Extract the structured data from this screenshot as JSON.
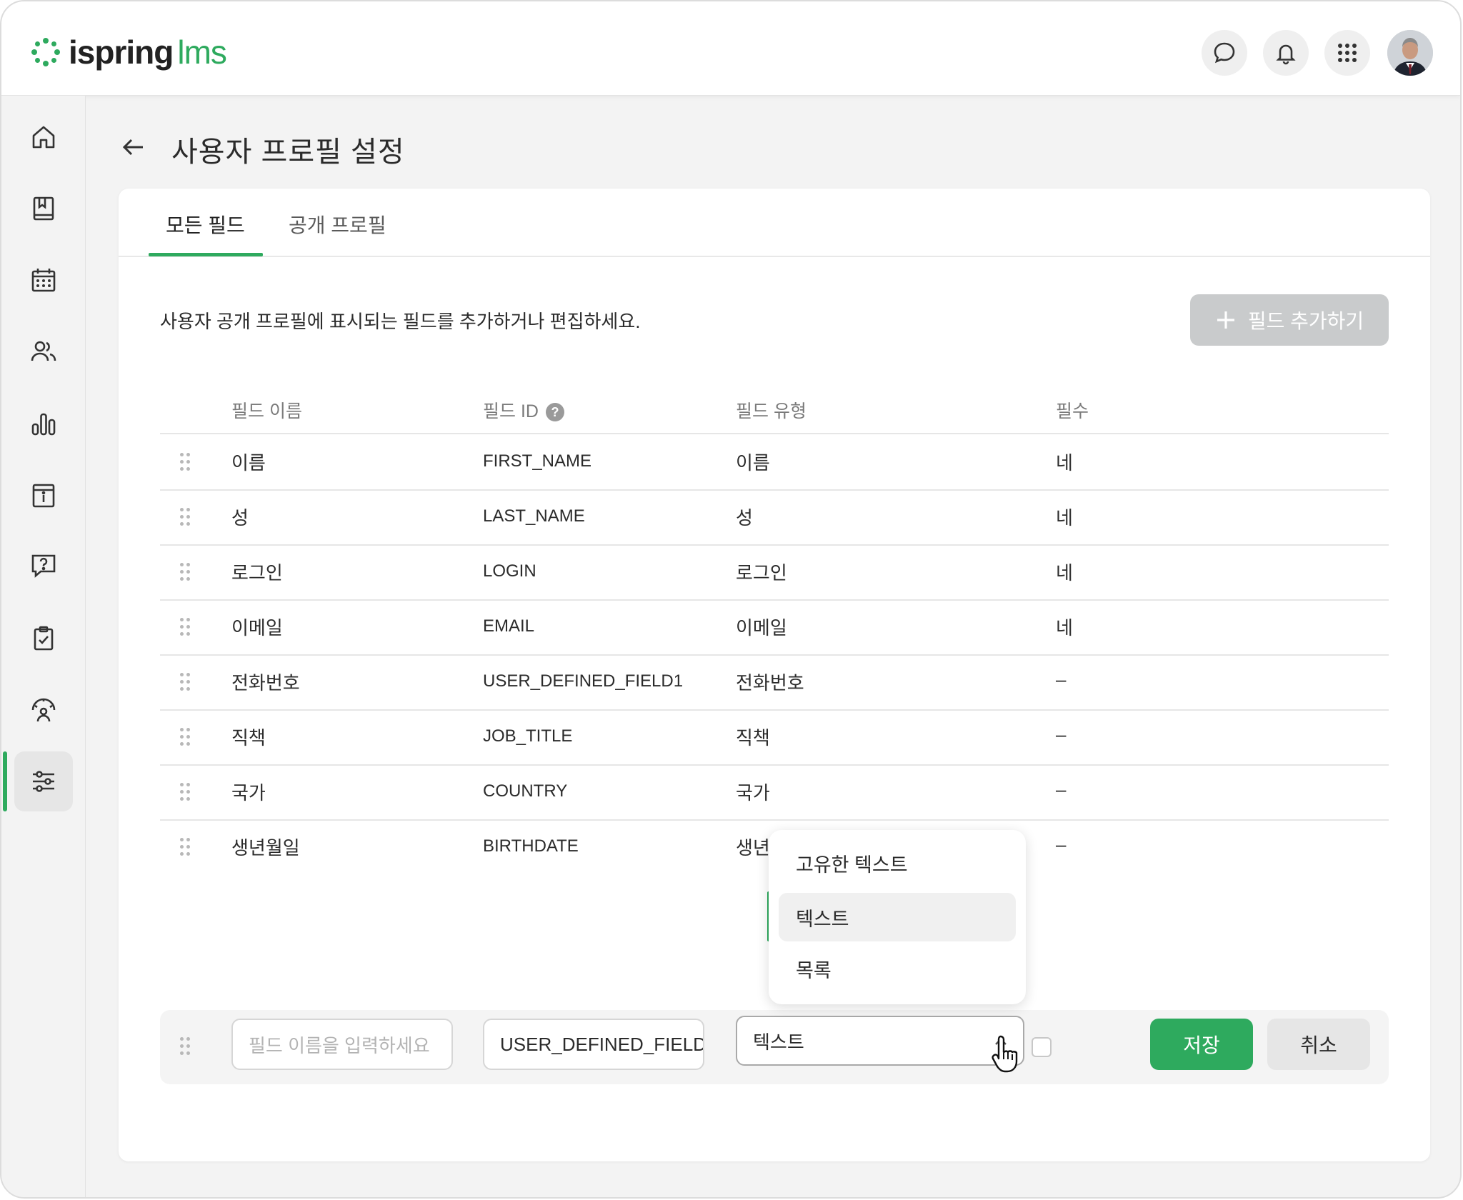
{
  "app": {
    "logo_brand": "ispring",
    "logo_product": "lms"
  },
  "header": {
    "icons": [
      "chat-icon",
      "bell-icon",
      "apps-grid-icon"
    ],
    "avatar": "user-avatar"
  },
  "sidebar": {
    "items": [
      {
        "name": "home-icon"
      },
      {
        "name": "book-icon"
      },
      {
        "name": "calendar-icon"
      },
      {
        "name": "users-icon"
      },
      {
        "name": "reports-icon"
      },
      {
        "name": "info-board-icon"
      },
      {
        "name": "question-icon"
      },
      {
        "name": "checklist-icon"
      },
      {
        "name": "user-gauge-icon"
      },
      {
        "name": "settings-sliders-icon",
        "active": true
      }
    ]
  },
  "page": {
    "title": "사용자 프로필 설정"
  },
  "tabs": [
    {
      "label": "모든 필드",
      "active": true
    },
    {
      "label": "공개 프로필",
      "active": false
    }
  ],
  "description": "사용자 공개 프로필에 표시되는 필드를 추가하거나 편집하세요.",
  "add_button": {
    "label": "필드 추가하기"
  },
  "table": {
    "headers": {
      "name": "필드 이름",
      "id": "필드 ID",
      "type": "필드 유형",
      "required": "필수"
    },
    "rows": [
      {
        "name": "이름",
        "id": "FIRST_NAME",
        "type": "이름",
        "required": "네"
      },
      {
        "name": "성",
        "id": "LAST_NAME",
        "type": "성",
        "required": "네"
      },
      {
        "name": "로그인",
        "id": "LOGIN",
        "type": "로그인",
        "required": "네"
      },
      {
        "name": "이메일",
        "id": "EMAIL",
        "type": "이메일",
        "required": "네"
      },
      {
        "name": "전화번호",
        "id": "USER_DEFINED_FIELD1",
        "type": "전화번호",
        "required": "–"
      },
      {
        "name": "직책",
        "id": "JOB_TITLE",
        "type": "직책",
        "required": "–"
      },
      {
        "name": "국가",
        "id": "COUNTRY",
        "type": "국가",
        "required": "–"
      },
      {
        "name": "생년월일",
        "id": "BIRTHDATE",
        "type": "생년월일",
        "required": "–"
      }
    ]
  },
  "new_field": {
    "name_placeholder": "필드 이름을 입력하세요",
    "id_value": "USER_DEFINED_FIELD",
    "type_value": "텍스트",
    "required_checked": false,
    "save_label": "저장",
    "cancel_label": "취소"
  },
  "type_dropdown": {
    "options": [
      "고유한 텍스트",
      "텍스트",
      "목록"
    ],
    "highlighted": "텍스트"
  },
  "colors": {
    "accent": "#2eaa5e",
    "disabled_button": "#c9cbcc"
  }
}
